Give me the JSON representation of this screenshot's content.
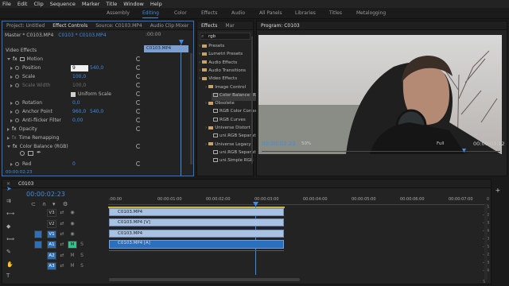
{
  "menu": [
    "File",
    "Edit",
    "Clip",
    "Sequence",
    "Marker",
    "Title",
    "Window",
    "Help"
  ],
  "workspaces": [
    "Assembly",
    "Editing",
    "Color",
    "Effects",
    "Audio",
    "All Panels",
    "Libraries",
    "Titles",
    "Metalogging"
  ],
  "workspace_active": "Editing",
  "effect_controls": {
    "tabs": [
      "Project: Untitled",
      "Effect Controls",
      "Source: C0103.MP4",
      "Audio Clip Mixer"
    ],
    "master_label": "Master * C0103.MP4",
    "sequence_label": "C0103 * C0103.MP4",
    "ruler_time": ":00:00",
    "clip_name": "C0103.MP4",
    "video_effects_label": "Video Effects",
    "motion_label": "Motion",
    "position_label": "Position",
    "position_x": "9",
    "position_y": "540,0",
    "scale_label": "Scale",
    "scale_value": "100,0",
    "scale_width_label": "Scale Width",
    "scale_width_value": "100,0",
    "uniform_scale_label": "Uniform Scale",
    "rotation_label": "Rotation",
    "rotation_value": "0,0",
    "anchor_label": "Anchor Point",
    "anchor_x": "960,0",
    "anchor_y": "540,0",
    "antiflicker_label": "Anti-flicker Filter",
    "antiflicker_value": "0,00",
    "opacity_label": "Opacity",
    "time_remap_label": "Time Remapping",
    "color_balance_label": "Color Balance (RGB)",
    "red_label": "Red",
    "red_value": "0",
    "timecode": "00:00:02:23"
  },
  "effects_panel": {
    "tabs": [
      "Effects",
      "Mar"
    ],
    "search_value": "rgb",
    "items": [
      {
        "label": "Presets",
        "level": 0
      },
      {
        "label": "Lumetri Presets",
        "level": 0
      },
      {
        "label": "Audio Effects",
        "level": 0
      },
      {
        "label": "Audio Transitions",
        "level": 0
      },
      {
        "label": "Video Effects",
        "level": 0
      },
      {
        "label": "Image Control",
        "level": 1
      },
      {
        "label": "Color Balance (RGB)",
        "level": 2
      },
      {
        "label": "Obsolete",
        "level": 1
      },
      {
        "label": "RGB Color Corrector",
        "level": 2
      },
      {
        "label": "RGB Curves",
        "level": 2
      },
      {
        "label": "Universe Distort",
        "level": 1
      },
      {
        "label": "uni.RGB Separation",
        "level": 2
      },
      {
        "label": "Universe Legacy",
        "level": 1
      },
      {
        "label": "uni.RGB Separation",
        "level": 2
      },
      {
        "label": "uni.Simple RGB",
        "level": 2
      }
    ]
  },
  "program_monitor": {
    "title": "Program: C0103",
    "timecode": "00:00:02:23",
    "zoom": "50%",
    "resolution": "Full",
    "duration": "00:00:03:12"
  },
  "timeline": {
    "tab": "C0103",
    "timecode": "00:00:02:23",
    "ruler_labels": [
      ":00:00",
      "00:00:01:00",
      "00:00:02:00",
      "00:00:03:00",
      "00:00:04:00",
      "00:00:05:00",
      "00:00:06:00",
      "00:00:07:00"
    ],
    "video_tracks": [
      "V3",
      "V2",
      "V1"
    ],
    "audio_tracks": [
      "A1",
      "A2",
      "A3"
    ],
    "clips": {
      "v3": "C0103.MP4",
      "v2": "C0103.MP4 [V]",
      "v1": "C0103.MP4",
      "a1": "C0103.MP4 [A]"
    },
    "meter_ticks": [
      "0",
      "-6",
      "-12",
      "-18",
      "-24",
      "-30",
      "-36",
      "-42",
      "-48",
      "-54"
    ]
  },
  "colors": {
    "accent": "#3d8de6",
    "playhead": "#3d8de6",
    "video_clip": "#a9c2e4",
    "audio_clip": "#2b6fbf"
  }
}
